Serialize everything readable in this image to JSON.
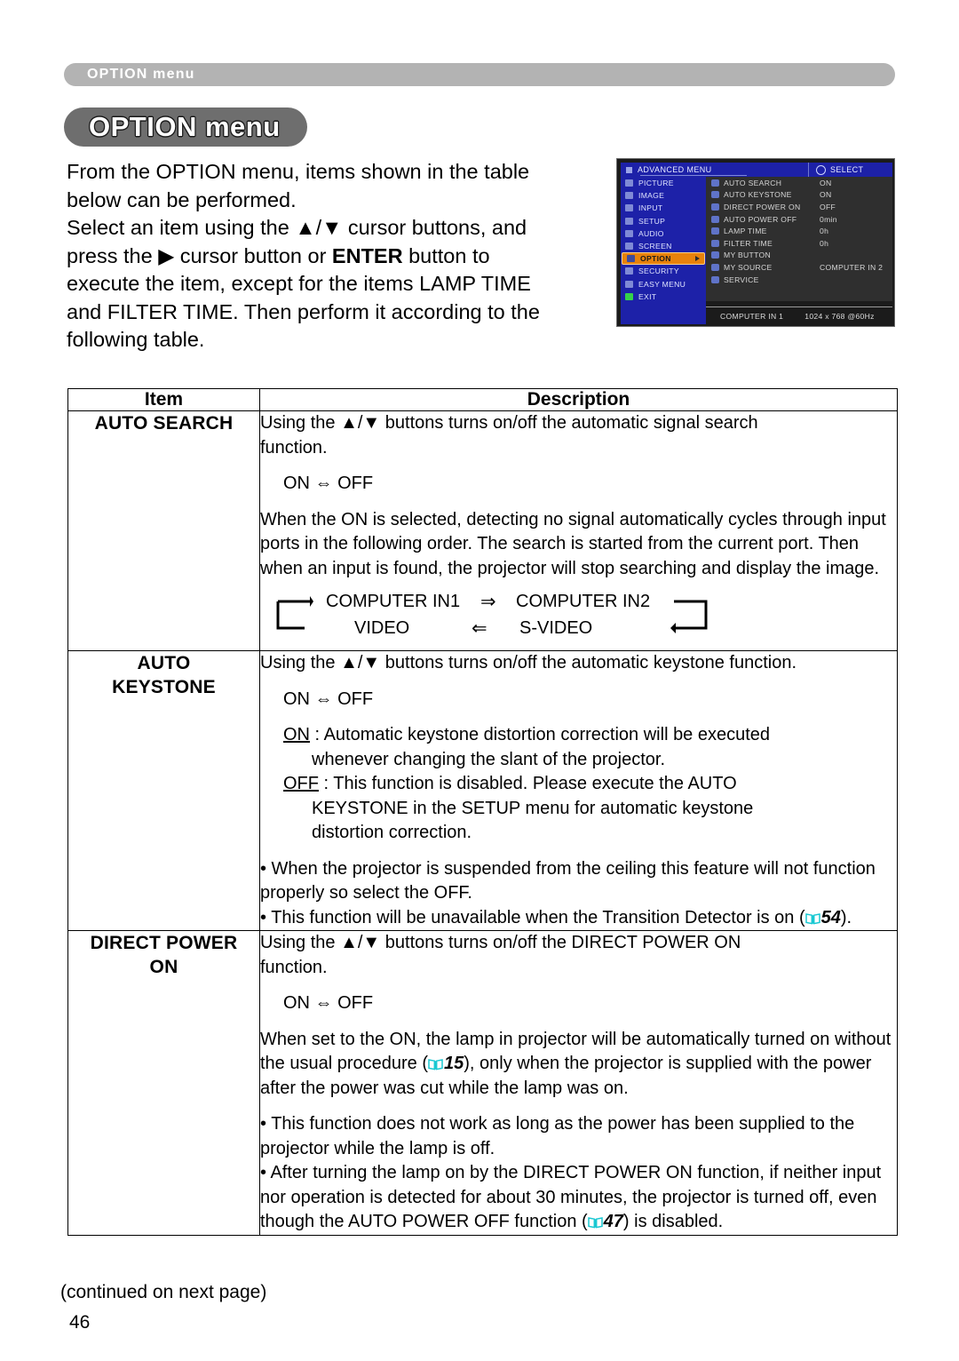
{
  "header": {
    "running_head": "OPTION menu",
    "title": "OPTION menu"
  },
  "intro": {
    "line1": "From the OPTION menu, items shown in the table",
    "line2": "below can be performed.",
    "line3_a": "Select an item using the ",
    "line3_updown": "▲/▼",
    "line3_b": " cursor buttons, and",
    "line4_a": "press the ",
    "line4_right": "▶",
    "line4_b": " cursor button or ",
    "line4_enter": "ENTER",
    "line4_c": " button to",
    "line5": "execute the item, except for the items LAMP TIME",
    "line6": "and FILTER TIME. Then perform it according to the",
    "line7": "following table."
  },
  "osd": {
    "title": "ADVANCED MENU",
    "select_label": "SELECT",
    "sidebar": [
      {
        "label": "PICTURE",
        "selected": false
      },
      {
        "label": "IMAGE",
        "selected": false
      },
      {
        "label": "INPUT",
        "selected": false
      },
      {
        "label": "SETUP",
        "selected": false
      },
      {
        "label": "AUDIO",
        "selected": false
      },
      {
        "label": "SCREEN",
        "selected": false
      },
      {
        "label": "OPTION",
        "selected": true
      },
      {
        "label": "SECURITY",
        "selected": false
      },
      {
        "label": "EASY MENU",
        "selected": false
      },
      {
        "label": "EXIT",
        "selected": false
      }
    ],
    "rows": [
      {
        "label": "AUTO SEARCH",
        "value": "ON"
      },
      {
        "label": "AUTO KEYSTONE",
        "value": "ON"
      },
      {
        "label": "DIRECT POWER ON",
        "value": "OFF"
      },
      {
        "label": "AUTO POWER OFF",
        "value": "0min"
      },
      {
        "label": "LAMP TIME",
        "value": "0h"
      },
      {
        "label": "FILTER TIME",
        "value": "0h"
      },
      {
        "label": "MY BUTTON",
        "value": ""
      },
      {
        "label": "MY SOURCE",
        "value": "COMPUTER IN 2"
      },
      {
        "label": "SERVICE",
        "value": ""
      }
    ],
    "status_source": "COMPUTER IN 1",
    "status_mode": "1024 x 768 @60Hz",
    "colors": {
      "menu_blue": "#1d21a8",
      "highlight_orange": "#e8820c",
      "panel_gray": "#2f2f2f"
    }
  },
  "table": {
    "headers": {
      "item": "Item",
      "description": "Description"
    },
    "rows": [
      {
        "item": "AUTO SEARCH",
        "p1_a": "Using the ",
        "p1_updown": "▲/▼",
        "p1_b": " buttons turns on/off the automatic signal search",
        "p1_c": "function.",
        "toggle": "ON ⇔ OFF",
        "p2": "When the ON is selected, detecting no signal automatically cycles through input ports in the following order. The search is started from the current port. Then when an input is found, the projector will stop searching and display the image.",
        "cycle": {
          "in1": "COMPUTER IN1",
          "in2": "COMPUTER IN2",
          "video": "VIDEO",
          "svideo": "S-VIDEO",
          "arrow_right": "⇒",
          "arrow_left": "⇐"
        }
      },
      {
        "item_line1": "AUTO",
        "item_line2": "KEYSTONE",
        "p1_a": "Using the ",
        "p1_updown": "▲/▼",
        "p1_b": " buttons turns on/off the automatic keystone function.",
        "toggle": "ON ⇔ OFF",
        "on_label": "ON",
        "on_text": " : Automatic keystone distortion correction will be executed",
        "on_text2": "whenever changing the slant of the projector.",
        "off_label": "OFF",
        "off_text": " : This function is disabled. Please execute the AUTO",
        "off_text2": "KEYSTONE in the SETUP menu for automatic keystone",
        "off_text3": "distortion correction.",
        "bullet1": "• When the projector is suspended from the ceiling this feature will not function properly so select the OFF.",
        "bullet2_a": "• This function will be unavailable when the Transition Detector is on (",
        "bullet2_ref": "54",
        "bullet2_b": ")."
      },
      {
        "item_line1": "DIRECT POWER",
        "item_line2": "ON",
        "p1_a": "Using the ",
        "p1_updown": "▲/▼",
        "p1_b": " buttons turns on/off the DIRECT POWER ON",
        "p1_c": "function.",
        "toggle": "ON ⇔ OFF",
        "p2_a": "When set to the ON, the lamp in projector will be automatically turned on without the usual procedure (",
        "p2_ref": "15",
        "p2_b": "), only when the projector is supplied with the power after the power was cut while the lamp was on.",
        "bullet1": "• This function does not work as long as the power has been supplied to the projector while the lamp is off.",
        "bullet2_a": "• After turning the lamp on by the DIRECT POWER ON function, if neither input nor operation is detected for about 30 minutes, the projector is turned off, even though the AUTO POWER OFF function (",
        "bullet2_ref": "47",
        "bullet2_b": ") is disabled."
      }
    ]
  },
  "footer": {
    "continued": "(continued on next page)",
    "page_number": "46"
  },
  "colors": {
    "book_icon": "#19c8d2",
    "running_head_band": "#b3b3b3",
    "title_pill": "#6e6e6e"
  }
}
